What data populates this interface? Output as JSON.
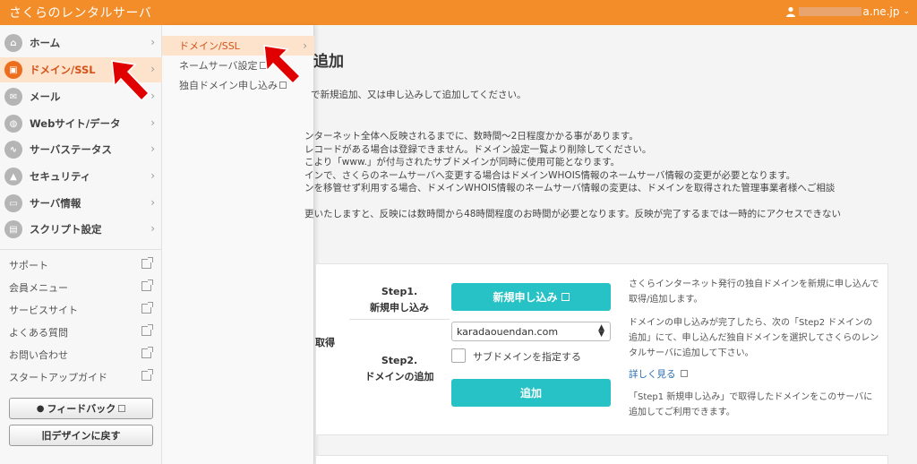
{
  "header": {
    "brand": "さくらのレンタルサーバ",
    "user_suffix": "a.ne.jp"
  },
  "sidebar": {
    "items": [
      {
        "label": "ホーム",
        "icon": "home-icon",
        "glyph": "⌂"
      },
      {
        "label": "ドメイン/SSL",
        "icon": "lock-icon",
        "glyph": "▣"
      },
      {
        "label": "メール",
        "icon": "mail-icon",
        "glyph": "✉"
      },
      {
        "label": "Webサイト/データ",
        "icon": "globe-icon",
        "glyph": "◍"
      },
      {
        "label": "サーバステータス",
        "icon": "chart-icon",
        "glyph": "∿"
      },
      {
        "label": "セキュリティ",
        "icon": "padlock-icon",
        "glyph": "▲"
      },
      {
        "label": "サーバ情報",
        "icon": "server-icon",
        "glyph": "▭"
      },
      {
        "label": "スクリプト設定",
        "icon": "script-icon",
        "glyph": "▤"
      }
    ],
    "links": [
      "サポート",
      "会員メニュー",
      "サービスサイト",
      "よくある質問",
      "お問い合わせ",
      "スタートアップガイド"
    ],
    "feedback_label": "フィードバック",
    "old_design_label": "旧デザインに戻す"
  },
  "submenu": {
    "items": [
      "ドメイン/SSL",
      "ネームサーバ設定",
      "独自ドメイン申し込み"
    ]
  },
  "main": {
    "title": "追加",
    "intro": "で新規追加、又は申し込みして追加してください。",
    "notes": [
      "ンターネット全体へ反映されるまでに、数時間〜2日程度かかる事があります。",
      "レコードがある場合は登録できません。ドメイン設定一覧より削除してください。",
      "こより「www.」が付与されたサブドメインが同時に使用可能となります。",
      "インで、さくらのネームサーバへ変更する場合はドメインWHOIS情報のネームサーバ情報の変更が必要となります。",
      "ンを移管せず利用する場合、ドメインWHOIS情報のネームサーバ情報の変更は、ドメインを取得された管理事業者様へご相談",
      "",
      "更いたしますと、反映には数時間から48時間程度のお時間が必要となります。反映が完了するまでは一時的にアクセスできない"
    ],
    "acquire_label": "取得",
    "step1_title": "Step1.",
    "step1_sub": "新規申し込み",
    "step1_button": "新規申し込み",
    "step2_title": "Step2.",
    "step2_sub": "ドメインの追加",
    "domain_select": "karadaouendan.com",
    "subdomain_label": "サブドメインを指定する",
    "add_button": "追加",
    "desc1": "さくらインターネット発行の独自ドメインを新規に申し込んで取得/追加します。",
    "desc2": "ドメインの申し込みが完了したら、次の「Step2 ドメインの追加」にて、申し込んだ独自ドメインを選択してさくらのレンタルサーバに追加して下さい。",
    "more_link": "詳しく見る",
    "desc3": "「Step1 新規申し込み」で取得したドメインをこのサーバに追加してご利用できます。"
  },
  "colors": {
    "header": "#f38d2a",
    "active_bg": "#fde3cc",
    "active_text": "#d4531a",
    "primary_button": "#26c2c6",
    "arrow": "#e00000"
  }
}
